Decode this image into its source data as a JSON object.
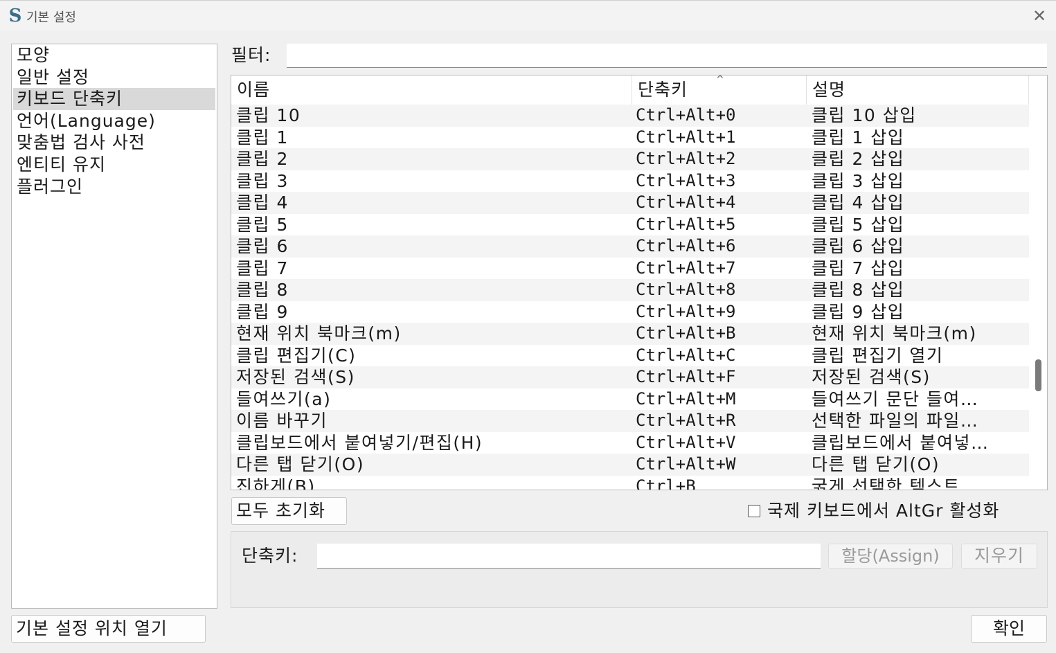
{
  "window": {
    "title": "기본 설정",
    "app_icon": "S",
    "close": "✕"
  },
  "sidebar": {
    "items": [
      {
        "label": "모양",
        "selected": false
      },
      {
        "label": "일반 설정",
        "selected": false
      },
      {
        "label": "키보드 단축키",
        "selected": true
      },
      {
        "label": "언어(Language)",
        "selected": false
      },
      {
        "label": "맞춤법 검사 사전",
        "selected": false
      },
      {
        "label": "엔티티 유지",
        "selected": false
      },
      {
        "label": "플러그인",
        "selected": false
      }
    ]
  },
  "open_location_button": "기본 설정 위치 열기",
  "filter": {
    "label": "필터:",
    "value": ""
  },
  "table": {
    "columns": [
      "이름",
      "단축키",
      "설명"
    ],
    "sort_indicator": "^",
    "rows": [
      {
        "name": "클립 10",
        "key": "Ctrl+Alt+0",
        "desc": "클립 10 삽입"
      },
      {
        "name": "클립 1",
        "key": "Ctrl+Alt+1",
        "desc": "클립 1 삽입"
      },
      {
        "name": "클립 2",
        "key": "Ctrl+Alt+2",
        "desc": "클립 2 삽입"
      },
      {
        "name": "클립 3",
        "key": "Ctrl+Alt+3",
        "desc": "클립 3 삽입"
      },
      {
        "name": "클립 4",
        "key": "Ctrl+Alt+4",
        "desc": "클립 4 삽입"
      },
      {
        "name": "클립 5",
        "key": "Ctrl+Alt+5",
        "desc": "클립 5 삽입"
      },
      {
        "name": "클립 6",
        "key": "Ctrl+Alt+6",
        "desc": "클립 6 삽입"
      },
      {
        "name": "클립 7",
        "key": "Ctrl+Alt+7",
        "desc": "클립 7 삽입"
      },
      {
        "name": "클립 8",
        "key": "Ctrl+Alt+8",
        "desc": "클립 8 삽입"
      },
      {
        "name": "클립 9",
        "key": "Ctrl+Alt+9",
        "desc": "클립 9 삽입"
      },
      {
        "name": "현재 위치 북마크(m)",
        "key": "Ctrl+Alt+B",
        "desc": "현재 위치 북마크(m)"
      },
      {
        "name": "클립 편집기(C)",
        "key": "Ctrl+Alt+C",
        "desc": "클립 편집기 열기"
      },
      {
        "name": "저장된 검색(S)",
        "key": "Ctrl+Alt+F",
        "desc": "저장된 검색(S)"
      },
      {
        "name": "들여쓰기(a)",
        "key": "Ctrl+Alt+M",
        "desc": "들여쓰기 문단 들여…"
      },
      {
        "name": "이름 바꾸기",
        "key": "Ctrl+Alt+R",
        "desc": "선택한 파일의 파일…"
      },
      {
        "name": "클립보드에서 붙여넣기/편집(H)",
        "key": "Ctrl+Alt+V",
        "desc": "클립보드에서 붙여넣…"
      },
      {
        "name": "다른 탭 닫기(O)",
        "key": "Ctrl+Alt+W",
        "desc": "다른 탭 닫기(O)"
      },
      {
        "name": "진하게(B)",
        "key": "Ctrl+B",
        "desc": "굵게 선택한 텍스트…"
      }
    ]
  },
  "reset_all_button": "모두 초기화",
  "altgr": {
    "label": "국제 키보드에서 AltGr 활성화",
    "checked": false
  },
  "shortcut": {
    "label": "단축키:",
    "value": "",
    "assign_button": "할당(Assign)",
    "clear_button": "지우기"
  },
  "ok_button": "확인",
  "colors": {
    "selection": "#d9d9d9",
    "row_alt": "#f4f4f4",
    "icon": "#3b6e87"
  }
}
